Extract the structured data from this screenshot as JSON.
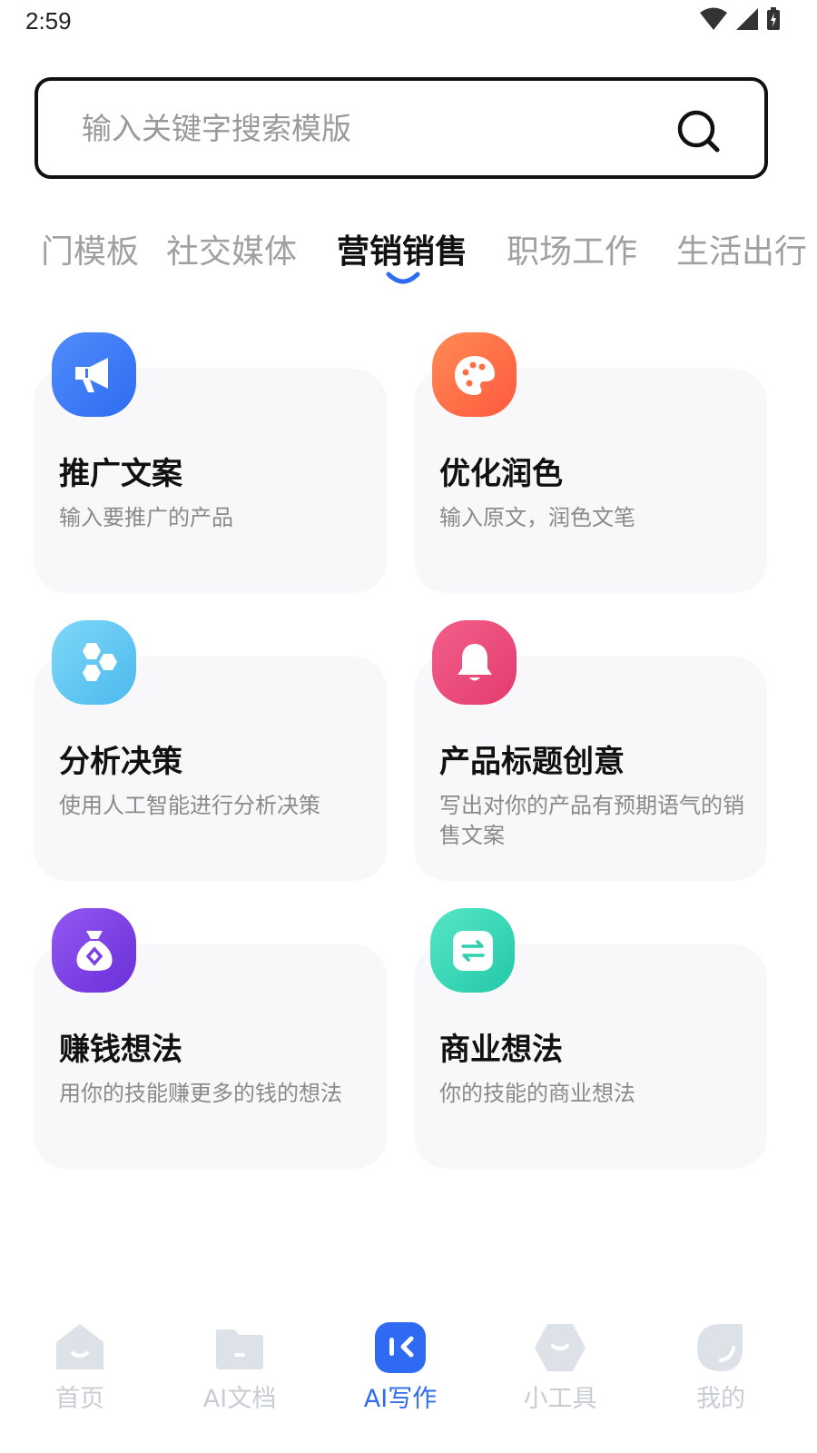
{
  "status_bar": {
    "time": "2:59"
  },
  "search": {
    "placeholder": "输入关键字搜索模版"
  },
  "tabs": [
    {
      "label": "门模板"
    },
    {
      "label": "社交媒体"
    },
    {
      "label": "营销销售",
      "active": true
    },
    {
      "label": "职场工作"
    },
    {
      "label": "生活出行"
    }
  ],
  "cards": [
    {
      "title": "推广文案",
      "desc": "输入要推广的产品",
      "icon": "megaphone-icon",
      "color": "#3d7cf5"
    },
    {
      "title": "优化润色",
      "desc": "输入原文，润色文笔",
      "icon": "palette-icon",
      "color": "#ff6f45"
    },
    {
      "title": "分析决策",
      "desc": "使用人工智能进行分析决策",
      "icon": "hexagons-icon",
      "color": "#5cc7f2"
    },
    {
      "title": "产品标题创意",
      "desc": "写出对你的产品有预期语气的销售文案",
      "icon": "bell-icon",
      "color": "#ec4a7c"
    },
    {
      "title": "赚钱想法",
      "desc": "用你的技能赚更多的钱的想法",
      "icon": "money-bag-icon",
      "color": "#7b3fe4"
    },
    {
      "title": "商业想法",
      "desc": "你的技能的商业想法",
      "icon": "exchange-icon",
      "color": "#36d6b5"
    }
  ],
  "bottom_nav": [
    {
      "label": "首页",
      "icon": "home-icon"
    },
    {
      "label": "AI文档",
      "icon": "folder-icon"
    },
    {
      "label": "AI写作",
      "icon": "ai-write-icon",
      "active": true
    },
    {
      "label": "小工具",
      "icon": "tools-icon"
    },
    {
      "label": "我的",
      "icon": "profile-icon"
    }
  ],
  "colors": {
    "accent": "#2f6bf2",
    "inactive": "#c8ccd4"
  }
}
